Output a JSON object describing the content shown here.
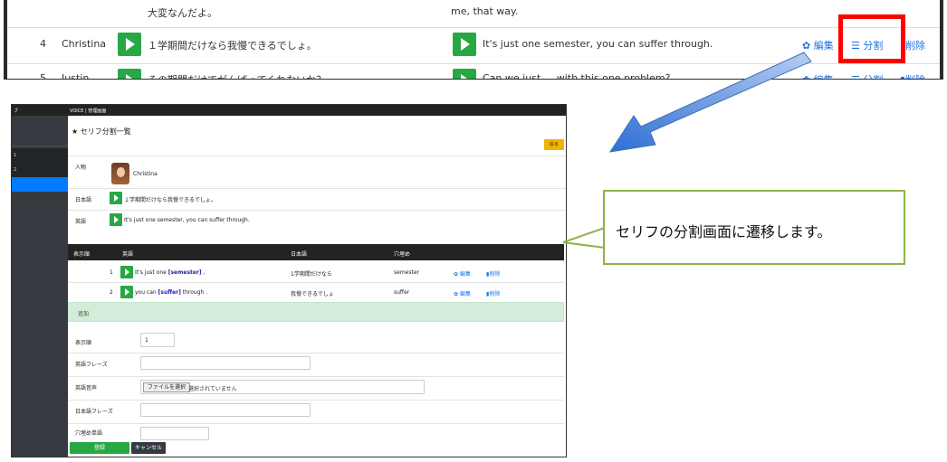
{
  "top_list": {
    "rows": [
      {
        "num": "",
        "name": "",
        "jp": "大変なんだよ。",
        "en": "me, that way."
      },
      {
        "num": "4",
        "name": "Christina",
        "jp": "１学期間だけなら我慢できるでしょ。",
        "en": "It's just one semester, you can suffer through."
      },
      {
        "num": "5",
        "name": "Justin",
        "jp": "その期間だけでがんばってくれないか？",
        "en": "Can we just ... with this one problem?"
      }
    ],
    "actions": {
      "edit": "編集",
      "split": "分割",
      "delete": "削除"
    }
  },
  "shot": {
    "topbar": {
      "left": "ブ",
      "title": "VOICE | 管理画面"
    },
    "sidebar": [
      "1",
      "2"
    ],
    "title": "セリフ分割一覧",
    "back": "戻る",
    "person_label": "人物",
    "person_name": "Christina",
    "jp_label": "日本語",
    "jp_text": "１学期間だけなら我慢できるでしょ。",
    "en_label": "英語",
    "en_text": "It's just one semester, you can suffer through.",
    "table": {
      "headers": [
        "表示順",
        "英語",
        "日本語",
        "穴埋め"
      ],
      "rows": [
        {
          "order": "1",
          "en_pre": "It's just one ",
          "en_hl": "[semester]",
          "en_post": " ,",
          "jp": "1学期間だけなら",
          "fill": "semester",
          "edit": "編集",
          "del": "削除"
        },
        {
          "order": "2",
          "en_pre": "you can ",
          "en_hl": "[suffer]",
          "en_post": " through .",
          "jp": "我慢できるでしょ",
          "fill": "suffer",
          "edit": "編集",
          "del": "削除"
        }
      ]
    },
    "add": "追加",
    "form": {
      "order_label": "表示順",
      "order_value": "1",
      "en_phrase_label": "英語フレーズ",
      "en_audio_label": "英語音声",
      "file_button": "ファイルを選択",
      "file_note": "選択されていません",
      "jp_phrase_label": "日本語フレーズ",
      "fill_word_label": "穴埋め単語"
    },
    "buttons": {
      "register": "登録",
      "cancel": "キャンセル"
    }
  },
  "callout": {
    "text": "セリフの分割画面に遷移します。"
  },
  "colors": {
    "accent": "#1a73e8",
    "play": "#28a745",
    "highlight": "#ff0000",
    "callout_border": "#8fb24a"
  }
}
